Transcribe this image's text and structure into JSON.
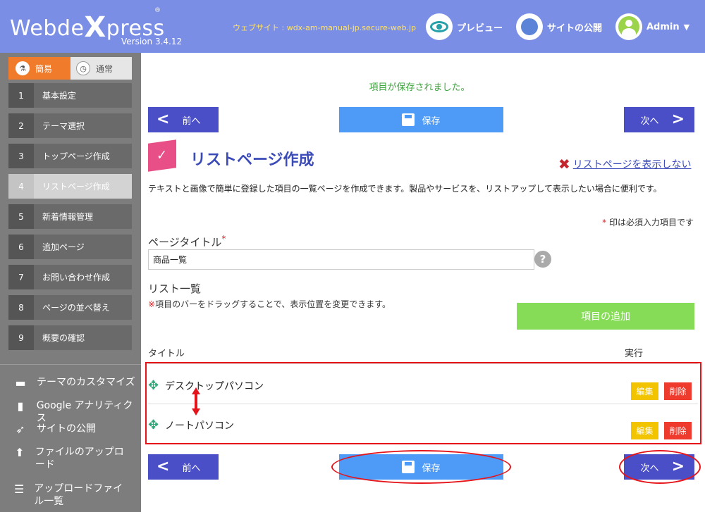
{
  "header": {
    "logo": "Webde",
    "logo_x": "X",
    "logo_suffix": "press",
    "logo_reg": "®",
    "version": "Version 3.4.12",
    "website": "ウェブサイト : wdx-am-manual-jp.secure-web.jp",
    "preview_label": "プレビュー",
    "publish_label": "サイトの公開",
    "user_label": "Admin",
    "caret": "▼"
  },
  "sidebar": {
    "mode_easy": "簡易",
    "mode_normal": "通常",
    "steps": [
      {
        "num": "1",
        "label": "基本設定"
      },
      {
        "num": "2",
        "label": "テーマ選択"
      },
      {
        "num": "3",
        "label": "トップページ作成"
      },
      {
        "num": "4",
        "label": "リストページ作成"
      },
      {
        "num": "5",
        "label": "新着情報管理"
      },
      {
        "num": "6",
        "label": "追加ページ"
      },
      {
        "num": "7",
        "label": "お問い合わせ作成"
      },
      {
        "num": "8",
        "label": "ページの並べ替え"
      },
      {
        "num": "9",
        "label": "概要の確認"
      }
    ],
    "tools": [
      {
        "label": "テーマのカスタマイズ",
        "icon": "paint-roller-icon"
      },
      {
        "label": "Google アナリティクス",
        "icon": "bar-chart-icon"
      },
      {
        "label": "サイトの公開",
        "icon": "rocket-icon"
      },
      {
        "label": "ファイルのアップロード",
        "icon": "upload-icon"
      },
      {
        "label": "アップロードファイル一覧",
        "icon": "list-icon"
      }
    ]
  },
  "main": {
    "saved_message": "項目が保存されました。",
    "prev_label": "前へ",
    "save_label": "保存",
    "next_label": "次へ",
    "page_title": "リストページ作成",
    "hide_link": "リストページを表示しない",
    "description": "テキストと画像で簡単に登録した項目の一覧ページを作成できます。製品やサービスを、リストアップして表示したい場合に便利です。",
    "required_note": "印は必須入力項目です",
    "required_star": "*",
    "page_title_label": "ページタイトル",
    "page_title_value": "商品一覧",
    "help": "?",
    "list_label": "リスト一覧",
    "list_note_mark": "※",
    "list_note": "項目のバーをドラッグすることで、表示位置を変更できます。",
    "add_button": "項目の追加",
    "col_title": "タイトル",
    "col_action": "実行",
    "items": [
      {
        "name": "デスクトップパソコン",
        "edit": "編集",
        "delete": "削除"
      },
      {
        "name": "ノートパソコン",
        "edit": "編集",
        "delete": "削除"
      }
    ]
  },
  "colors": {
    "header": "#7b8ee6",
    "sidebar": "#7d7d7d",
    "nav_button": "#4a4fc7",
    "save_button": "#4d9af7",
    "add_button": "#86dc57",
    "edit_button": "#f2c400",
    "delete_button": "#ef3a2e",
    "highlight": "#e5141b"
  }
}
